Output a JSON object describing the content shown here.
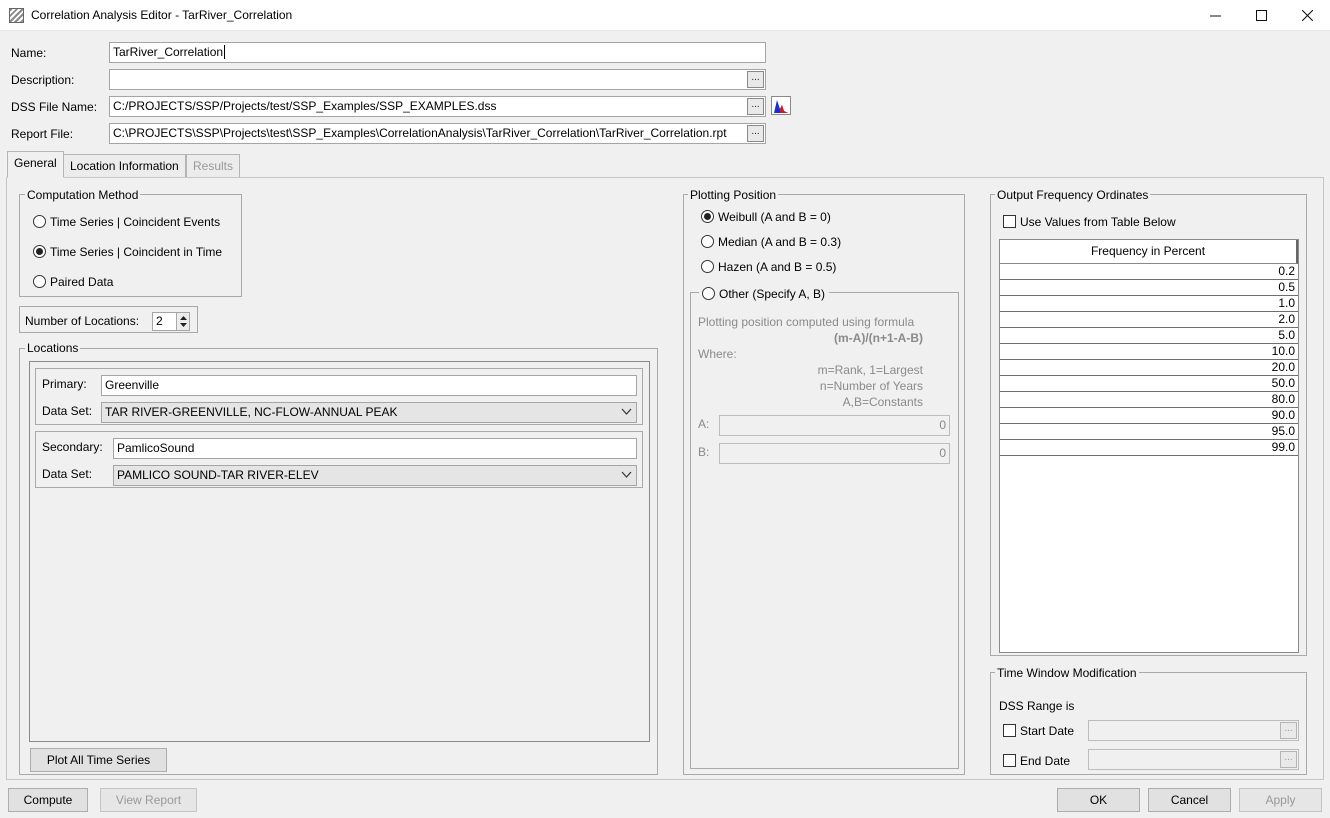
{
  "window": {
    "title": "Correlation Analysis Editor - TarRiver_Correlation"
  },
  "form": {
    "name_label": "Name:",
    "name_value": "TarRiver_Correlation",
    "description_label": "Description:",
    "description_value": "",
    "dss_label": "DSS File Name:",
    "dss_value": "C:/PROJECTS/SSP/Projects/test/SSP_Examples/SSP_EXAMPLES.dss",
    "report_label": "Report File:",
    "report_value": "C:\\PROJECTS\\SSP\\Projects\\test\\SSP_Examples\\CorrelationAnalysis\\TarRiver_Correlation\\TarRiver_Correlation.rpt",
    "ellipsis": "..."
  },
  "tabs": [
    {
      "label": "General"
    },
    {
      "label": "Location Information"
    },
    {
      "label": "Results"
    }
  ],
  "computation": {
    "title": "Computation Method",
    "options": [
      {
        "label": "Time Series | Coincident Events",
        "selected": false
      },
      {
        "label": "Time Series | Coincident in Time",
        "selected": true
      },
      {
        "label": "Paired Data",
        "selected": false
      }
    ]
  },
  "num_locations": {
    "label": "Number of Locations:",
    "value": "2"
  },
  "locations": {
    "title": "Locations",
    "primary_label": "Primary:",
    "primary_value": "Greenville",
    "primary_dataset_label": "Data Set:",
    "primary_dataset_value": "TAR RIVER-GREENVILLE, NC-FLOW-ANNUAL PEAK",
    "secondary_label": "Secondary:",
    "secondary_value": "PamlicoSound",
    "secondary_dataset_label": "Data Set:",
    "secondary_dataset_value": "PAMLICO SOUND-TAR RIVER-ELEV",
    "plot_button": "Plot All Time Series"
  },
  "plotting": {
    "title": "Plotting Position",
    "options": [
      {
        "label": "Weibull (A and B = 0)",
        "selected": true
      },
      {
        "label": "Median (A and B = 0.3)",
        "selected": false
      },
      {
        "label": "Hazen (A and B = 0.5)",
        "selected": false
      }
    ],
    "other_label": "Other (Specify A, B)",
    "formula_caption": "Plotting position computed using formula",
    "formula": "(m-A)/(n+1-A-B)",
    "where": "Where:",
    "def_m": "m=Rank, 1=Largest",
    "def_n": "n=Number of Years",
    "def_ab": "A,B=Constants",
    "a_label": "A:",
    "a_value": "0",
    "b_label": "B:",
    "b_value": "0"
  },
  "ordinates": {
    "title": "Output Frequency Ordinates",
    "use_values_label": "Use Values from Table Below",
    "use_values_checked": false,
    "column_header": "Frequency in Percent",
    "values": [
      "0.2",
      "0.5",
      "1.0",
      "2.0",
      "5.0",
      "10.0",
      "20.0",
      "50.0",
      "80.0",
      "90.0",
      "95.0",
      "99.0"
    ]
  },
  "time_window": {
    "title": "Time Window Modification",
    "dss_range": "DSS Range is",
    "start_label": "Start Date",
    "end_label": "End Date"
  },
  "buttons": {
    "compute": "Compute",
    "view_report": "View Report",
    "ok": "OK",
    "cancel": "Cancel",
    "apply": "Apply"
  }
}
